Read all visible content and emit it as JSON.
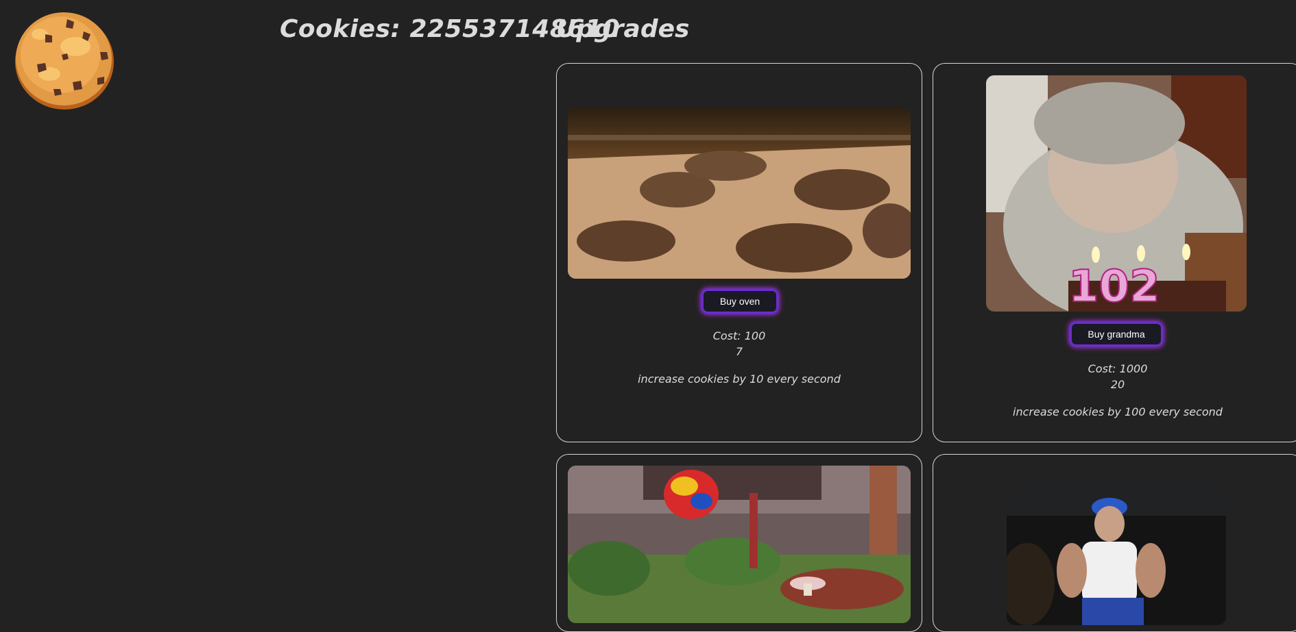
{
  "header": {
    "cookie_label": "Cookies:",
    "cookie_count": "225537148610",
    "upgrades_title": "Upgrades"
  },
  "upgrades": [
    {
      "image": "cookies-baking-in-oven-image",
      "button_label": "Buy oven",
      "cost_label": "Cost: 100",
      "owned": "7",
      "description": "increase cookies by 10 every second"
    },
    {
      "image": "grandma-birthday-candles-image",
      "button_label": "Buy grandma",
      "cost_label": "Cost: 1000",
      "owned": "20",
      "description": "increase cookies by 100 every second"
    },
    {
      "image": "candy-factory-garden-image"
    },
    {
      "image": "worker-with-blue-helmet-image"
    }
  ],
  "colors": {
    "background": "#222222",
    "card_border": "#d8d8d8",
    "button_glow_blue": "#6a2bd6",
    "button_glow_pink": "#e628c8"
  }
}
